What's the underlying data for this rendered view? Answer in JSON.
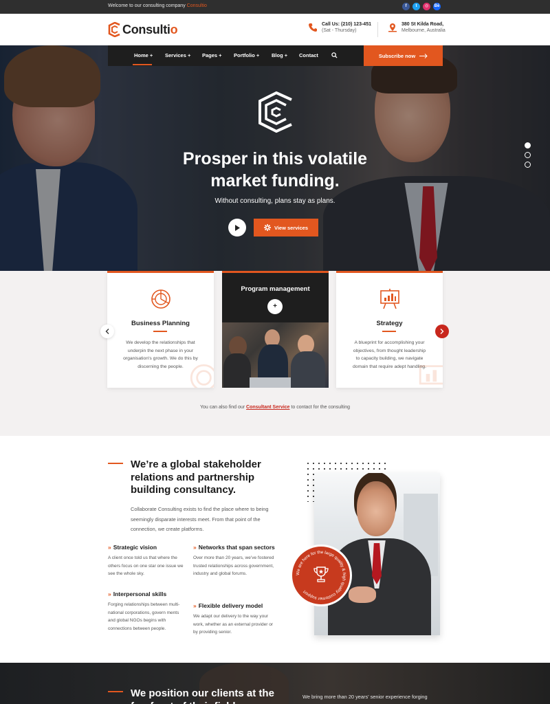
{
  "topbar": {
    "welcome_text": "Welcome to our consulting company",
    "welcome_brand": "Consultio",
    "social": [
      {
        "icon": "facebook-icon",
        "glyph": "f",
        "color": "#3b5998"
      },
      {
        "icon": "twitter-icon",
        "glyph": "t",
        "color": "#1da1f2"
      },
      {
        "icon": "instagram-icon",
        "glyph": "◎",
        "color": "#e1306c"
      },
      {
        "icon": "behance-icon",
        "glyph": "Bē",
        "color": "#1769ff"
      }
    ]
  },
  "header": {
    "logo_main": "Consulti",
    "logo_accent": "o",
    "phone_label": "Call Us: (210) 123-451",
    "phone_hours": "(Sat - Thursday)",
    "address_line1": "380 St Kilda Road,",
    "address_line2": "Melbourne, Australia"
  },
  "nav": {
    "items": [
      "Home +",
      "Services +",
      "Pages +",
      "Portfolio +",
      "Blog +",
      "Contact"
    ],
    "subscribe_label": "Subscribe now"
  },
  "hero": {
    "title_line1": "Prosper in this volatile",
    "title_line2": "market funding.",
    "subtitle": "Without consulting, plans stay as plans.",
    "view_label": "View services"
  },
  "services": {
    "cards": [
      {
        "title": "Business Planning",
        "text": "We develop the relationships that underpin the next phase in your organisation's growth. We do this by discerning the people."
      },
      {
        "title": "Program management"
      },
      {
        "title": "Strategy",
        "text": "A blueprint for accomplishing your objectives, from thought leadership to capacity building, we navigate domain that require adept handling."
      }
    ],
    "note_prefix": "You can also find our",
    "note_link": "Consultant Service",
    "note_suffix": "to contact for the consulting"
  },
  "about": {
    "title": "We’re a global stakeholder relations and partnership building consultancy.",
    "text": "Collaborate Consulting exists to find the place where to being seemingly disparate interests meet. From that point of the connection, we create platforms.",
    "features": [
      {
        "title": "Strategic vision",
        "text": "A client once told us that where the others focus on one star one issue we see the whole sky."
      },
      {
        "title": "Networks that span sectors",
        "text": "Over more than 20 years, we’ve fostered trusted relationships across government, industry and global forums."
      },
      {
        "title": "Interpersonal skills",
        "text": "Forging relationships between multi-national corporations, govern ments and global NGOs begins with connections between people."
      },
      {
        "title": "Flexible delivery model",
        "text": "We adapt our delivery to the way your work, whether as an external provider or by providing senior."
      }
    ],
    "badge_text": "We are here for the large quality & high quality customer support"
  },
  "cta": {
    "title": "We position our clients at the forefront of their field",
    "text": "We bring more than 20 years’ senior experience forging"
  },
  "colors": {
    "accent": "#e2571f",
    "dark": "#1e1e1e"
  }
}
